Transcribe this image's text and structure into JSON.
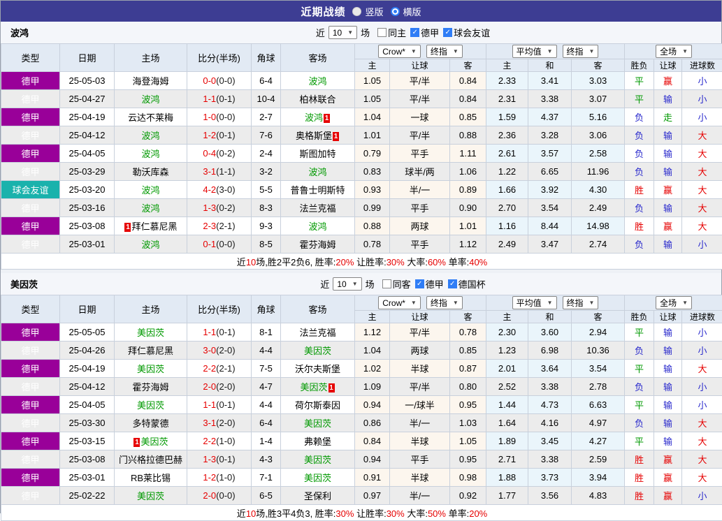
{
  "header": {
    "title": "近期战绩",
    "vertical_label": "竖版",
    "horizontal_label": "横版",
    "vertical_selected": false,
    "horizontal_selected": true
  },
  "icons": {
    "dropdown_arrow": "▼",
    "checkbox_check": "✓"
  },
  "colors": {
    "topbar": "#3d3d93",
    "league_badge": "#990099",
    "friendly_badge": "#1ab2ac",
    "team_highlight": "#009900",
    "win_red": "#e60000",
    "lose_blue": "#2828cc",
    "draw_green": "#009900",
    "odds_bg": "#fcf6ee",
    "avg_bg": "#eaf5fb"
  },
  "table_header": {
    "type": "类型",
    "date": "日期",
    "home": "主场",
    "score": "比分(半场)",
    "corner": "角球",
    "away": "客场",
    "odds_source": "Crow*",
    "odds_stage": "终指",
    "avg_source": "平均值",
    "avg_stage": "终指",
    "scope": "全场",
    "sub": [
      "主",
      "让球",
      "客",
      "主",
      "和",
      "客",
      "胜负",
      "让球",
      "进球数"
    ]
  },
  "sections": [
    {
      "team": "波鸿",
      "filter": {
        "near_label": "近",
        "games_value": "10",
        "games_label": "场",
        "checkboxes": [
          {
            "label": "同主",
            "checked": false
          },
          {
            "label": "德甲",
            "checked": true
          },
          {
            "label": "球会友谊",
            "checked": true
          }
        ]
      },
      "rows": [
        {
          "type": "德甲",
          "type_style": "league",
          "date": "25-05-03",
          "home": {
            "name": "海登海姆",
            "green": false
          },
          "score_ft": "0-0",
          "score_ht": "(0-0)",
          "corner": "6-4",
          "away": {
            "name": "波鸿",
            "green": true
          },
          "odds": [
            "1.05",
            "平/半",
            "0.84"
          ],
          "avg": [
            "2.33",
            "3.41",
            "3.03"
          ],
          "outcome": [
            {
              "t": "平",
              "c": "green"
            },
            {
              "t": "赢",
              "c": "red"
            },
            {
              "t": "小",
              "c": "blue"
            }
          ]
        },
        {
          "type": "德甲",
          "type_style": "league",
          "date": "25-04-27",
          "home": {
            "name": "波鸿",
            "green": true
          },
          "score_ft": "1-1",
          "score_ht": "(0-1)",
          "corner": "10-4",
          "away": {
            "name": "柏林联合",
            "green": false
          },
          "odds": [
            "1.05",
            "平/半",
            "0.84"
          ],
          "avg": [
            "2.31",
            "3.38",
            "3.07"
          ],
          "outcome": [
            {
              "t": "平",
              "c": "green"
            },
            {
              "t": "输",
              "c": "blue"
            },
            {
              "t": "小",
              "c": "blue"
            }
          ]
        },
        {
          "type": "德甲",
          "type_style": "league",
          "date": "25-04-19",
          "home": {
            "name": "云达不莱梅",
            "green": false
          },
          "score_ft": "1-0",
          "score_ht": "(0-0)",
          "corner": "2-7",
          "away": {
            "name": "波鸿",
            "green": true,
            "card_after": "1"
          },
          "odds": [
            "1.04",
            "一球",
            "0.85"
          ],
          "avg": [
            "1.59",
            "4.37",
            "5.16"
          ],
          "outcome": [
            {
              "t": "负",
              "c": "blue"
            },
            {
              "t": "走",
              "c": "green"
            },
            {
              "t": "小",
              "c": "blue"
            }
          ]
        },
        {
          "type": "德甲",
          "type_style": "league",
          "date": "25-04-12",
          "home": {
            "name": "波鸿",
            "green": true
          },
          "score_ft": "1-2",
          "score_ht": "(0-1)",
          "corner": "7-6",
          "away": {
            "name": "奥格斯堡",
            "green": false,
            "card_after": "1"
          },
          "odds": [
            "1.01",
            "平/半",
            "0.88"
          ],
          "avg": [
            "2.36",
            "3.28",
            "3.06"
          ],
          "outcome": [
            {
              "t": "负",
              "c": "blue"
            },
            {
              "t": "输",
              "c": "blue"
            },
            {
              "t": "大",
              "c": "red"
            }
          ]
        },
        {
          "type": "德甲",
          "type_style": "league",
          "date": "25-04-05",
          "home": {
            "name": "波鸿",
            "green": true
          },
          "score_ft": "0-4",
          "score_ht": "(0-2)",
          "corner": "2-4",
          "away": {
            "name": "斯图加特",
            "green": false
          },
          "odds": [
            "0.79",
            "平手",
            "1.11"
          ],
          "avg": [
            "2.61",
            "3.57",
            "2.58"
          ],
          "outcome": [
            {
              "t": "负",
              "c": "blue"
            },
            {
              "t": "输",
              "c": "blue"
            },
            {
              "t": "大",
              "c": "red"
            }
          ]
        },
        {
          "type": "德甲",
          "type_style": "league",
          "date": "25-03-29",
          "home": {
            "name": "勒沃库森",
            "green": false
          },
          "score_ft": "3-1",
          "score_ht": "(1-1)",
          "corner": "3-2",
          "away": {
            "name": "波鸿",
            "green": true
          },
          "odds": [
            "0.83",
            "球半/两",
            "1.06"
          ],
          "avg": [
            "1.22",
            "6.65",
            "11.96"
          ],
          "outcome": [
            {
              "t": "负",
              "c": "blue"
            },
            {
              "t": "输",
              "c": "blue"
            },
            {
              "t": "大",
              "c": "red"
            }
          ]
        },
        {
          "type": "球会友谊",
          "type_style": "friendly",
          "date": "25-03-20",
          "home": {
            "name": "波鸿",
            "green": true
          },
          "score_ft": "4-2",
          "score_ht": "(3-0)",
          "corner": "5-5",
          "away": {
            "name": "普鲁士明斯特",
            "green": false
          },
          "odds": [
            "0.93",
            "半/一",
            "0.89"
          ],
          "avg": [
            "1.66",
            "3.92",
            "4.30"
          ],
          "outcome": [
            {
              "t": "胜",
              "c": "red"
            },
            {
              "t": "赢",
              "c": "red"
            },
            {
              "t": "大",
              "c": "red"
            }
          ]
        },
        {
          "type": "德甲",
          "type_style": "league",
          "date": "25-03-16",
          "home": {
            "name": "波鸿",
            "green": true
          },
          "score_ft": "1-3",
          "score_ht": "(0-2)",
          "corner": "8-3",
          "away": {
            "name": "法兰克福",
            "green": false
          },
          "odds": [
            "0.99",
            "平手",
            "0.90"
          ],
          "avg": [
            "2.70",
            "3.54",
            "2.49"
          ],
          "outcome": [
            {
              "t": "负",
              "c": "blue"
            },
            {
              "t": "输",
              "c": "blue"
            },
            {
              "t": "大",
              "c": "red"
            }
          ]
        },
        {
          "type": "德甲",
          "type_style": "league",
          "date": "25-03-08",
          "home": {
            "name": "拜仁慕尼黑",
            "green": false,
            "card_before": "1"
          },
          "score_ft": "2-3",
          "score_ht": "(2-1)",
          "corner": "9-3",
          "away": {
            "name": "波鸿",
            "green": true
          },
          "odds": [
            "0.88",
            "两球",
            "1.01"
          ],
          "avg": [
            "1.16",
            "8.44",
            "14.98"
          ],
          "outcome": [
            {
              "t": "胜",
              "c": "red"
            },
            {
              "t": "赢",
              "c": "red"
            },
            {
              "t": "大",
              "c": "red"
            }
          ]
        },
        {
          "type": "德甲",
          "type_style": "league",
          "date": "25-03-01",
          "home": {
            "name": "波鸿",
            "green": true
          },
          "score_ft": "0-1",
          "score_ht": "(0-0)",
          "corner": "8-5",
          "away": {
            "name": "霍芬海姆",
            "green": false
          },
          "odds": [
            "0.78",
            "平手",
            "1.12"
          ],
          "avg": [
            "2.49",
            "3.47",
            "2.74"
          ],
          "outcome": [
            {
              "t": "负",
              "c": "blue"
            },
            {
              "t": "输",
              "c": "blue"
            },
            {
              "t": "小",
              "c": "blue"
            }
          ]
        }
      ],
      "summary": [
        {
          "t": "近"
        },
        {
          "t": "10",
          "red": true
        },
        {
          "t": "场,胜2平2负6, 胜率:"
        },
        {
          "t": "20%",
          "red": true
        },
        {
          "t": " 让胜率:"
        },
        {
          "t": "30%",
          "red": true
        },
        {
          "t": " 大率:"
        },
        {
          "t": "60%",
          "red": true
        },
        {
          "t": " 单率:"
        },
        {
          "t": "40%",
          "red": true
        }
      ]
    },
    {
      "team": "美因茨",
      "filter": {
        "near_label": "近",
        "games_value": "10",
        "games_label": "场",
        "checkboxes": [
          {
            "label": "同客",
            "checked": false
          },
          {
            "label": "德甲",
            "checked": true
          },
          {
            "label": "德国杯",
            "checked": true
          }
        ]
      },
      "rows": [
        {
          "type": "德甲",
          "type_style": "league",
          "date": "25-05-05",
          "home": {
            "name": "美因茨",
            "green": true
          },
          "score_ft": "1-1",
          "score_ht": "(0-1)",
          "corner": "8-1",
          "away": {
            "name": "法兰克福",
            "green": false
          },
          "odds": [
            "1.12",
            "平/半",
            "0.78"
          ],
          "avg": [
            "2.30",
            "3.60",
            "2.94"
          ],
          "outcome": [
            {
              "t": "平",
              "c": "green"
            },
            {
              "t": "输",
              "c": "blue"
            },
            {
              "t": "小",
              "c": "blue"
            }
          ]
        },
        {
          "type": "德甲",
          "type_style": "league",
          "date": "25-04-26",
          "home": {
            "name": "拜仁慕尼黑",
            "green": false
          },
          "score_ft": "3-0",
          "score_ht": "(2-0)",
          "corner": "4-4",
          "away": {
            "name": "美因茨",
            "green": true
          },
          "odds": [
            "1.04",
            "两球",
            "0.85"
          ],
          "avg": [
            "1.23",
            "6.98",
            "10.36"
          ],
          "outcome": [
            {
              "t": "负",
              "c": "blue"
            },
            {
              "t": "输",
              "c": "blue"
            },
            {
              "t": "小",
              "c": "blue"
            }
          ]
        },
        {
          "type": "德甲",
          "type_style": "league",
          "date": "25-04-19",
          "home": {
            "name": "美因茨",
            "green": true
          },
          "score_ft": "2-2",
          "score_ht": "(2-1)",
          "corner": "7-5",
          "away": {
            "name": "沃尔夫斯堡",
            "green": false
          },
          "odds": [
            "1.02",
            "半球",
            "0.87"
          ],
          "avg": [
            "2.01",
            "3.64",
            "3.54"
          ],
          "outcome": [
            {
              "t": "平",
              "c": "green"
            },
            {
              "t": "输",
              "c": "blue"
            },
            {
              "t": "大",
              "c": "red"
            }
          ]
        },
        {
          "type": "德甲",
          "type_style": "league",
          "date": "25-04-12",
          "home": {
            "name": "霍芬海姆",
            "green": false
          },
          "score_ft": "2-0",
          "score_ht": "(2-0)",
          "corner": "4-7",
          "away": {
            "name": "美因茨",
            "green": true,
            "card_after": "1"
          },
          "odds": [
            "1.09",
            "平/半",
            "0.80"
          ],
          "avg": [
            "2.52",
            "3.38",
            "2.78"
          ],
          "outcome": [
            {
              "t": "负",
              "c": "blue"
            },
            {
              "t": "输",
              "c": "blue"
            },
            {
              "t": "小",
              "c": "blue"
            }
          ]
        },
        {
          "type": "德甲",
          "type_style": "league",
          "date": "25-04-05",
          "home": {
            "name": "美因茨",
            "green": true
          },
          "score_ft": "1-1",
          "score_ht": "(0-1)",
          "corner": "4-4",
          "away": {
            "name": "荷尔斯泰因",
            "green": false
          },
          "odds": [
            "0.94",
            "一/球半",
            "0.95"
          ],
          "avg": [
            "1.44",
            "4.73",
            "6.63"
          ],
          "outcome": [
            {
              "t": "平",
              "c": "green"
            },
            {
              "t": "输",
              "c": "blue"
            },
            {
              "t": "小",
              "c": "blue"
            }
          ]
        },
        {
          "type": "德甲",
          "type_style": "league",
          "date": "25-03-30",
          "home": {
            "name": "多特蒙德",
            "green": false
          },
          "score_ft": "3-1",
          "score_ht": "(2-0)",
          "corner": "6-4",
          "away": {
            "name": "美因茨",
            "green": true
          },
          "odds": [
            "0.86",
            "半/一",
            "1.03"
          ],
          "avg": [
            "1.64",
            "4.16",
            "4.97"
          ],
          "outcome": [
            {
              "t": "负",
              "c": "blue"
            },
            {
              "t": "输",
              "c": "blue"
            },
            {
              "t": "大",
              "c": "red"
            }
          ]
        },
        {
          "type": "德甲",
          "type_style": "league",
          "date": "25-03-15",
          "home": {
            "name": "美因茨",
            "green": true,
            "card_before": "1"
          },
          "score_ft": "2-2",
          "score_ht": "(1-0)",
          "corner": "1-4",
          "away": {
            "name": "弗赖堡",
            "green": false
          },
          "odds": [
            "0.84",
            "半球",
            "1.05"
          ],
          "avg": [
            "1.89",
            "3.45",
            "4.27"
          ],
          "outcome": [
            {
              "t": "平",
              "c": "green"
            },
            {
              "t": "输",
              "c": "blue"
            },
            {
              "t": "大",
              "c": "red"
            }
          ]
        },
        {
          "type": "德甲",
          "type_style": "league",
          "date": "25-03-08",
          "home": {
            "name": "门兴格拉德巴赫",
            "green": false
          },
          "score_ft": "1-3",
          "score_ht": "(0-1)",
          "corner": "4-3",
          "away": {
            "name": "美因茨",
            "green": true
          },
          "odds": [
            "0.94",
            "平手",
            "0.95"
          ],
          "avg": [
            "2.71",
            "3.38",
            "2.59"
          ],
          "outcome": [
            {
              "t": "胜",
              "c": "red"
            },
            {
              "t": "赢",
              "c": "red"
            },
            {
              "t": "大",
              "c": "red"
            }
          ]
        },
        {
          "type": "德甲",
          "type_style": "league",
          "date": "25-03-01",
          "home": {
            "name": "RB莱比锡",
            "green": false
          },
          "score_ft": "1-2",
          "score_ht": "(1-0)",
          "corner": "7-1",
          "away": {
            "name": "美因茨",
            "green": true
          },
          "odds": [
            "0.91",
            "半球",
            "0.98"
          ],
          "avg": [
            "1.88",
            "3.73",
            "3.94"
          ],
          "outcome": [
            {
              "t": "胜",
              "c": "red"
            },
            {
              "t": "赢",
              "c": "red"
            },
            {
              "t": "大",
              "c": "red"
            }
          ]
        },
        {
          "type": "德甲",
          "type_style": "league",
          "date": "25-02-22",
          "home": {
            "name": "美因茨",
            "green": true
          },
          "score_ft": "2-0",
          "score_ht": "(0-0)",
          "corner": "6-5",
          "away": {
            "name": "圣保利",
            "green": false
          },
          "odds": [
            "0.97",
            "半/一",
            "0.92"
          ],
          "avg": [
            "1.77",
            "3.56",
            "4.83"
          ],
          "outcome": [
            {
              "t": "胜",
              "c": "red"
            },
            {
              "t": "赢",
              "c": "red"
            },
            {
              "t": "小",
              "c": "blue"
            }
          ]
        }
      ],
      "summary": [
        {
          "t": "近"
        },
        {
          "t": "10",
          "red": true
        },
        {
          "t": "场,胜3平4负3, 胜率:"
        },
        {
          "t": "30%",
          "red": true
        },
        {
          "t": " 让胜率:"
        },
        {
          "t": "30%",
          "red": true
        },
        {
          "t": " 大率:"
        },
        {
          "t": "50%",
          "red": true
        },
        {
          "t": " 单率:"
        },
        {
          "t": "20%",
          "red": true
        }
      ]
    }
  ]
}
